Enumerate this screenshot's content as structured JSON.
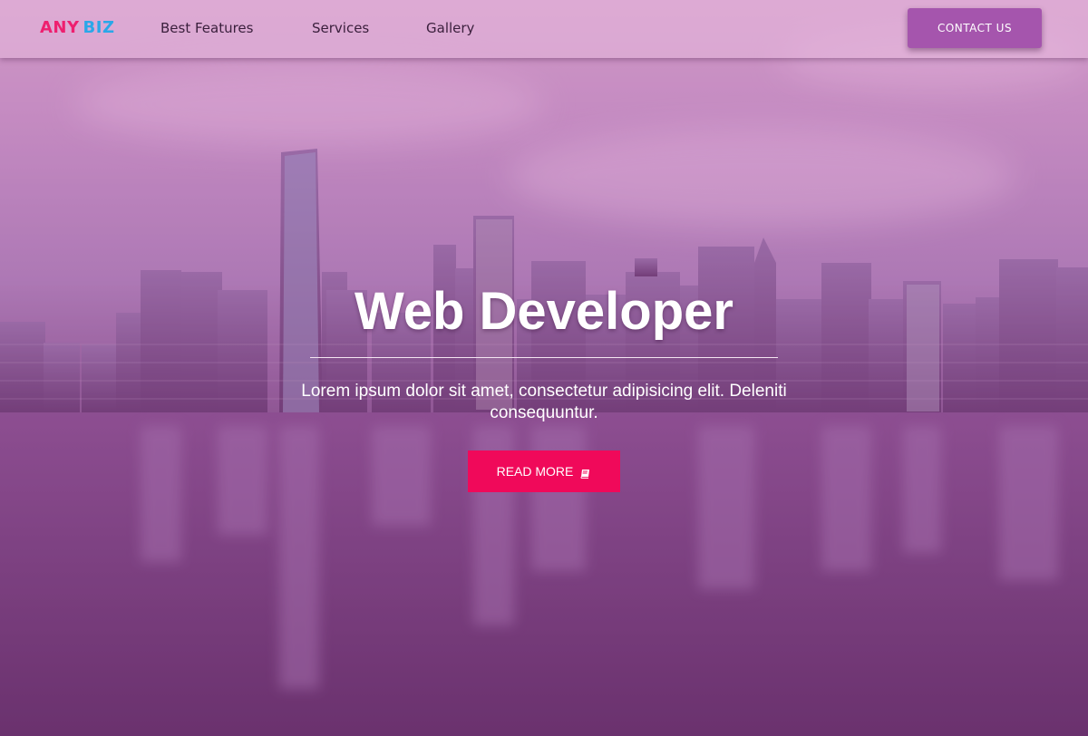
{
  "brand": {
    "part1": "ANY",
    "part2": "BIZ"
  },
  "nav": {
    "links": [
      {
        "label": "Best Features"
      },
      {
        "label": "Services"
      },
      {
        "label": "Gallery"
      }
    ],
    "contact_label": "CONTACT US"
  },
  "hero": {
    "title": "Web Developer",
    "subtitle": "Lorem ipsum dolor sit amet, consectetur adipisicing elit. Deleniti consequuntur.",
    "cta_label": "READ MORE",
    "cta_icon": "book-icon"
  },
  "colors": {
    "brand_pink": "#ee1f6f",
    "brand_blue": "#2aa7e8",
    "contact_button": "#a555ad",
    "cta_button": "#f0095a"
  }
}
